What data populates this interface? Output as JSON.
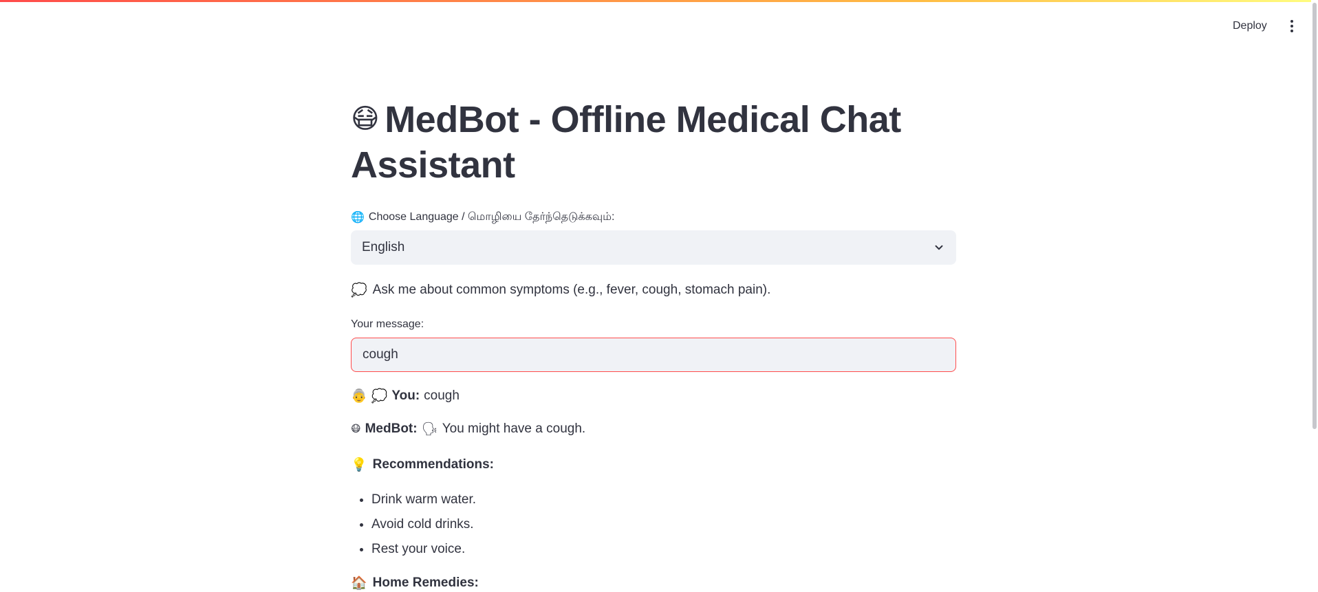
{
  "header": {
    "deploy_label": "Deploy"
  },
  "main": {
    "title_icon": "😷",
    "title": "MedBot - Offline Medical Chat Assistant",
    "language": {
      "label_icon": "🌐",
      "label": "Choose Language / மொழியை தேர்ந்தெடுக்கவும்:",
      "selected": "English"
    },
    "info": {
      "icon": "💭",
      "text": "Ask me about common symptoms (e.g., fever, cough, stomach pain)."
    },
    "message": {
      "label": "Your message:",
      "value": "cough"
    },
    "chat": {
      "user_icons": "👵 💭",
      "user_name": "You:",
      "user_text": "cough",
      "bot_icon": "😷",
      "bot_name": "MedBot:",
      "bot_reply_icon": "🗣",
      "bot_text": "You might have a cough."
    },
    "recommendations": {
      "icon": "💡",
      "title": "Recommendations:",
      "items": [
        "Drink warm water.",
        "Avoid cold drinks.",
        "Rest your voice."
      ]
    },
    "home_remedies": {
      "icon": "🏠",
      "title": "Home Remedies:"
    }
  },
  "colors": {
    "accent": "#ff4b4b",
    "text": "#31333f",
    "input_bg": "#f0f2f6"
  }
}
